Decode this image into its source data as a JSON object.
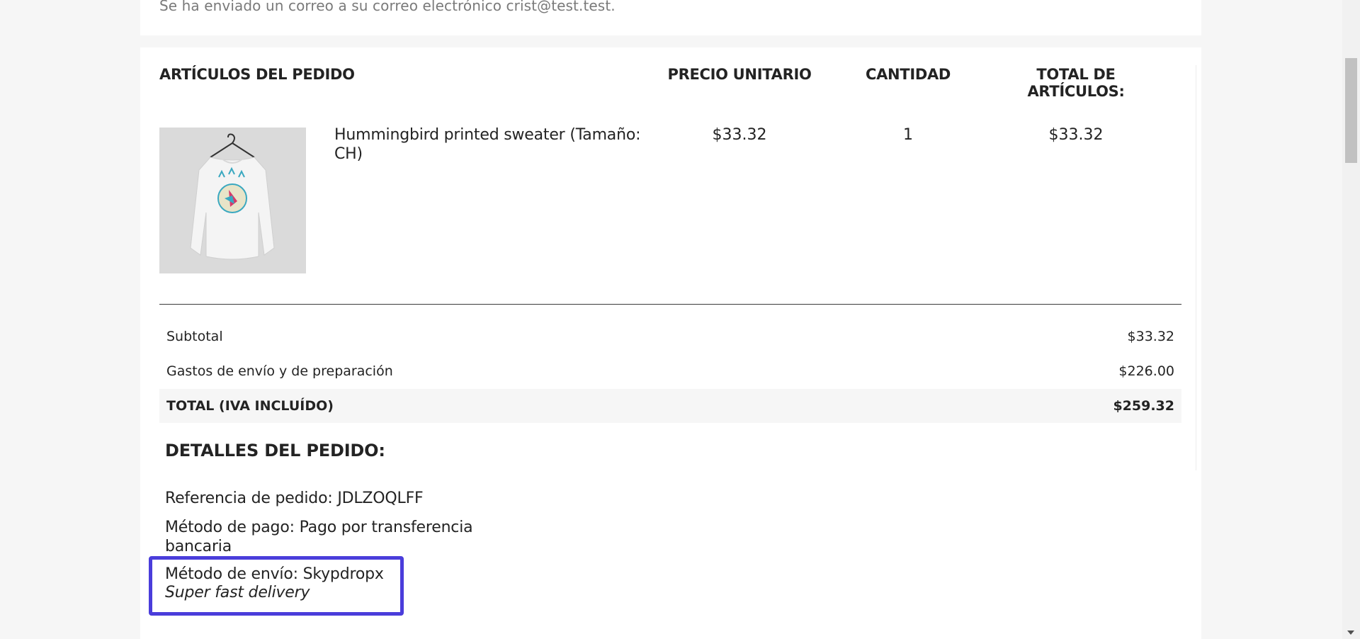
{
  "confirmation": {
    "email_text": "Se ha enviado un correo a su correo electrónico crist@test.test."
  },
  "table": {
    "headers": {
      "items": "ARTÍCULOS DEL PEDIDO",
      "unit_price": "PRECIO UNITARIO",
      "quantity": "CANTIDAD",
      "total_items": "TOTAL DE ARTÍCULOS:"
    },
    "rows": [
      {
        "image_icon": "sweater-product-image",
        "name": "Hummingbird printed sweater (Tamaño: CH)",
        "unit_price": "$33.32",
        "quantity": "1",
        "total": "$33.32"
      }
    ]
  },
  "totals": {
    "subtotal_label": "Subtotal",
    "subtotal_value": "$33.32",
    "shipping_label": "Gastos de envío y de preparación",
    "shipping_value": "$226.00",
    "total_label": "TOTAL (IVA INCLUÍDO)",
    "total_value": "$259.32"
  },
  "details": {
    "title": "DETALLES DEL PEDIDO:",
    "reference": "Referencia de pedido: JDLZOQLFF",
    "payment": "Método de pago: Pago por transferencia bancaria",
    "shipping_method": "Método de envío: Skypdropx",
    "shipping_note": "Super fast delivery"
  },
  "colors": {
    "highlight": "#4a3ddb",
    "page_background": "#f6f6f6"
  }
}
